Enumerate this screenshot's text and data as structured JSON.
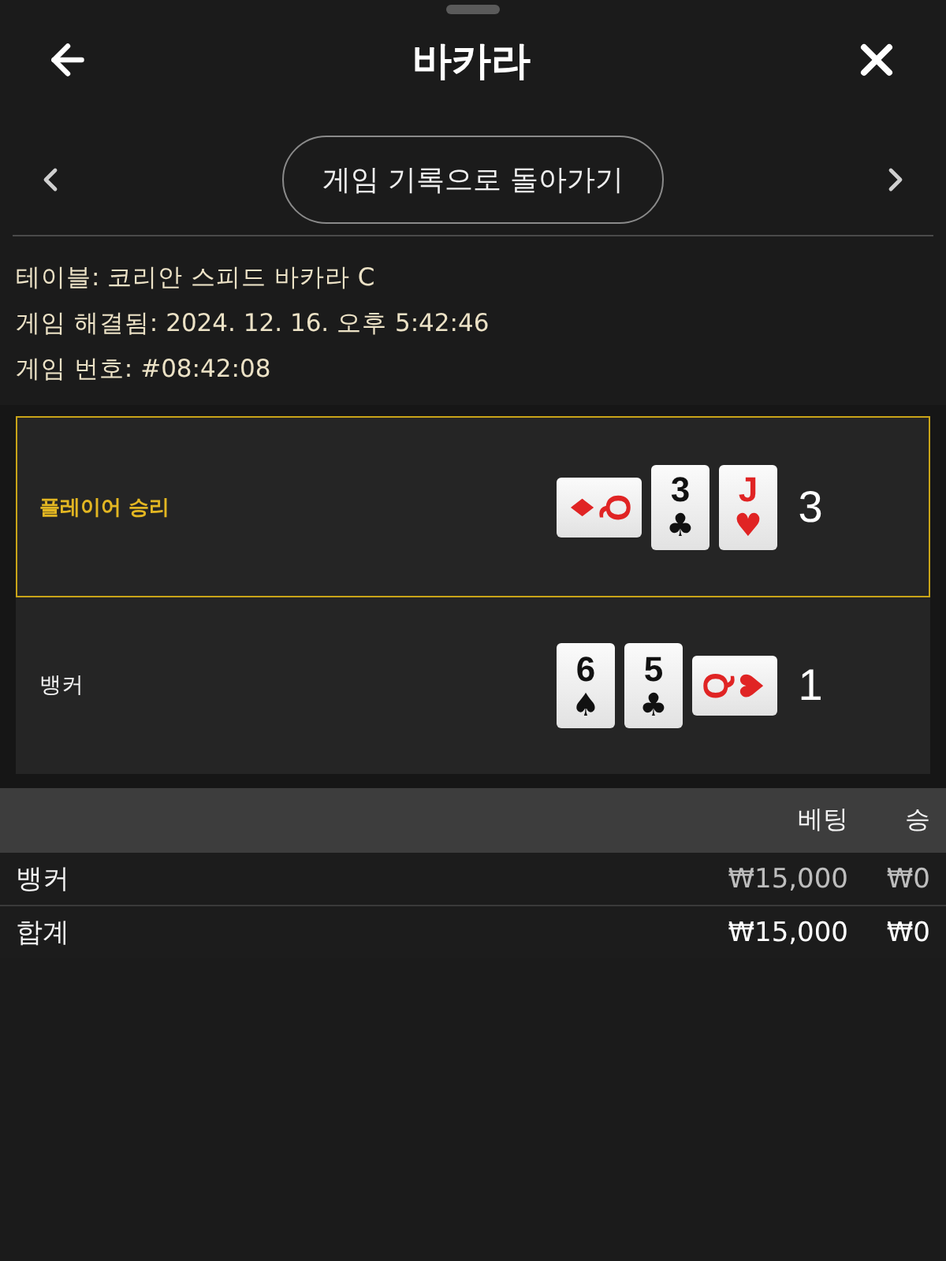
{
  "header": {
    "title": "바카라"
  },
  "nav": {
    "back_to_history": "게임 기록으로 돌아가기"
  },
  "game_info": [
    "테이블: 코리안 스피드 바카라 C",
    "게임 해결됨: 2024. 12. 16. 오후 5:42:46",
    "게임 번호: #08:42:08"
  ],
  "hands": [
    {
      "label": "플레이어 승리",
      "winner": true,
      "cards": [
        {
          "kind": "clockwise",
          "rank": "Q",
          "suit": "♦",
          "color": "#e02424"
        },
        {
          "kind": "upright",
          "rank": "3",
          "suit": "♣",
          "color": "#111111"
        },
        {
          "kind": "upright",
          "rank": "J",
          "suit": "♥",
          "color": "#e02424"
        }
      ],
      "score": "3"
    },
    {
      "label": "뱅커",
      "winner": false,
      "cards": [
        {
          "kind": "upright",
          "rank": "6",
          "suit": "♠",
          "color": "#111111"
        },
        {
          "kind": "upright",
          "rank": "5",
          "suit": "♣",
          "color": "#111111"
        },
        {
          "kind": "counterclockwise",
          "rank": "Q",
          "suit": "♥",
          "color": "#e02424"
        }
      ],
      "score": "1"
    }
  ],
  "bets_table": {
    "columns": [
      "베팅",
      "승"
    ],
    "rows": [
      {
        "kind": "bet",
        "label": "뱅커",
        "cells": [
          "₩15,000",
          "₩0"
        ]
      },
      {
        "kind": "total",
        "label": "합계",
        "cells": [
          "₩15,000",
          "₩0"
        ]
      }
    ]
  }
}
